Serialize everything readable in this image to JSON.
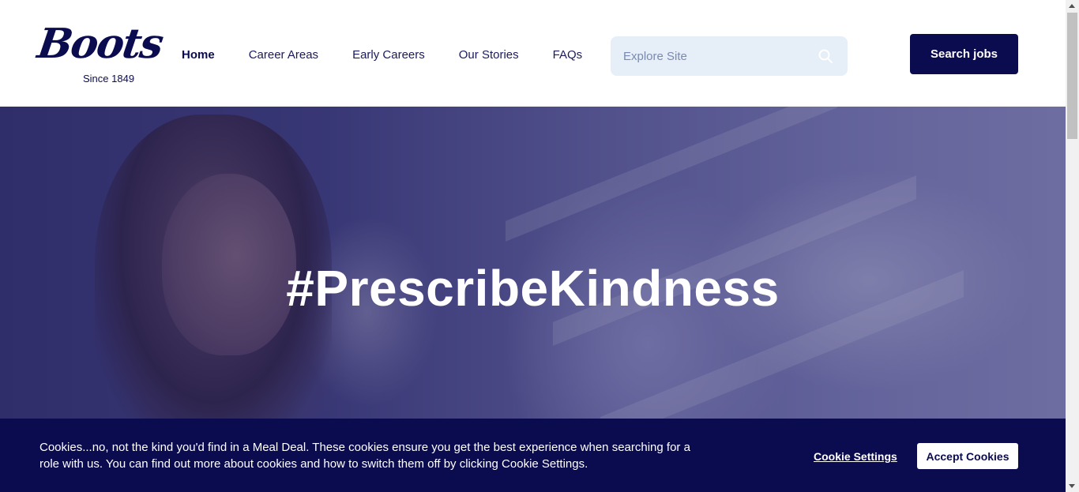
{
  "header": {
    "logo_text": "Boots",
    "logo_subtext": "Since 1849",
    "nav": [
      {
        "label": "Home",
        "active": true
      },
      {
        "label": "Career Areas"
      },
      {
        "label": "Early Careers"
      },
      {
        "label": "Our Stories"
      },
      {
        "label": "FAQs"
      }
    ],
    "search": {
      "placeholder": "Explore Site",
      "icon": "search-icon"
    },
    "search_jobs_label": "Search jobs"
  },
  "hero": {
    "title": "#PrescribeKindness"
  },
  "cookie_banner": {
    "text": "Cookies...no, not the kind you'd find in a Meal Deal. These cookies ensure you get the best experience when searching for a role with us. You can find out more about cookies and how to switch them off by clicking Cookie Settings.",
    "settings_label": "Cookie Settings",
    "accept_label": "Accept Cookies"
  },
  "colors": {
    "brand_navy": "#0b0b4f",
    "search_bg": "#e6eef8",
    "white": "#ffffff"
  }
}
